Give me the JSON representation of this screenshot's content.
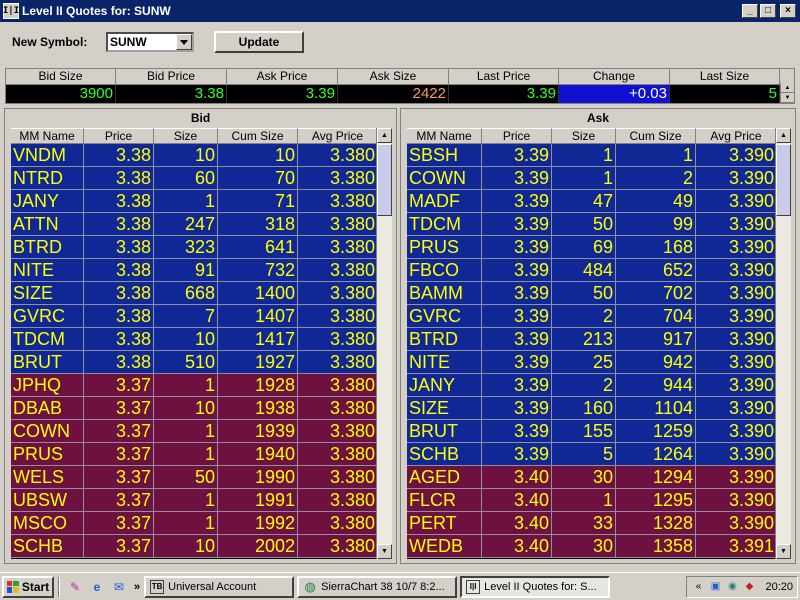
{
  "window": {
    "title": "Level II Quotes for: SUNW",
    "app_icon_text": "I|I",
    "min": "_",
    "max": "□",
    "close": "×"
  },
  "symbol": {
    "label": "New Symbol:",
    "value": "SUNW",
    "update_label": "Update"
  },
  "summary": {
    "headers": [
      "Bid Size",
      "Bid Price",
      "Ask Price",
      "Ask Size",
      "Last Price",
      "Change",
      "Last Size"
    ],
    "values": [
      "3900",
      "3.38",
      "3.39",
      "2422",
      "3.39",
      "+0.03",
      "5"
    ],
    "colors": {
      "bid_size": "#33ff33",
      "bid_price": "#33ff33",
      "ask_price": "#33ff33",
      "ask_size": "#ff9966",
      "last_price": "#33ff33",
      "change": "#ffffff",
      "change_bg": "#1010d0",
      "last_size": "#33ff33"
    }
  },
  "bid": {
    "title": "Bid",
    "columns": [
      "MM Name",
      "Price",
      "Size",
      "Cum Size",
      "Avg Price"
    ],
    "rows": [
      {
        "mm": "VNDM",
        "price": "3.38",
        "size": "10",
        "cum": "10",
        "avg": "3.380",
        "level": "blue"
      },
      {
        "mm": "NTRD",
        "price": "3.38",
        "size": "60",
        "cum": "70",
        "avg": "3.380",
        "level": "blue"
      },
      {
        "mm": "JANY",
        "price": "3.38",
        "size": "1",
        "cum": "71",
        "avg": "3.380",
        "level": "blue"
      },
      {
        "mm": "ATTN",
        "price": "3.38",
        "size": "247",
        "cum": "318",
        "avg": "3.380",
        "level": "blue"
      },
      {
        "mm": "BTRD",
        "price": "3.38",
        "size": "323",
        "cum": "641",
        "avg": "3.380",
        "level": "blue"
      },
      {
        "mm": "NITE",
        "price": "3.38",
        "size": "91",
        "cum": "732",
        "avg": "3.380",
        "level": "blue"
      },
      {
        "mm": "SIZE",
        "price": "3.38",
        "size": "668",
        "cum": "1400",
        "avg": "3.380",
        "level": "blue"
      },
      {
        "mm": "GVRC",
        "price": "3.38",
        "size": "7",
        "cum": "1407",
        "avg": "3.380",
        "level": "blue"
      },
      {
        "mm": "TDCM",
        "price": "3.38",
        "size": "10",
        "cum": "1417",
        "avg": "3.380",
        "level": "blue"
      },
      {
        "mm": "BRUT",
        "price": "3.38",
        "size": "510",
        "cum": "1927",
        "avg": "3.380",
        "level": "blue"
      },
      {
        "mm": "JPHQ",
        "price": "3.37",
        "size": "1",
        "cum": "1928",
        "avg": "3.380",
        "level": "maroon"
      },
      {
        "mm": "DBAB",
        "price": "3.37",
        "size": "10",
        "cum": "1938",
        "avg": "3.380",
        "level": "maroon"
      },
      {
        "mm": "COWN",
        "price": "3.37",
        "size": "1",
        "cum": "1939",
        "avg": "3.380",
        "level": "maroon"
      },
      {
        "mm": "PRUS",
        "price": "3.37",
        "size": "1",
        "cum": "1940",
        "avg": "3.380",
        "level": "maroon"
      },
      {
        "mm": "WELS",
        "price": "3.37",
        "size": "50",
        "cum": "1990",
        "avg": "3.380",
        "level": "maroon"
      },
      {
        "mm": "UBSW",
        "price": "3.37",
        "size": "1",
        "cum": "1991",
        "avg": "3.380",
        "level": "maroon"
      },
      {
        "mm": "MSCO",
        "price": "3.37",
        "size": "1",
        "cum": "1992",
        "avg": "3.380",
        "level": "maroon"
      },
      {
        "mm": "SCHB",
        "price": "3.37",
        "size": "10",
        "cum": "2002",
        "avg": "3.380",
        "level": "maroon"
      }
    ]
  },
  "ask": {
    "title": "Ask",
    "columns": [
      "MM Name",
      "Price",
      "Size",
      "Cum Size",
      "Avg Price"
    ],
    "rows": [
      {
        "mm": "SBSH",
        "price": "3.39",
        "size": "1",
        "cum": "1",
        "avg": "3.390",
        "level": "blue"
      },
      {
        "mm": "COWN",
        "price": "3.39",
        "size": "1",
        "cum": "2",
        "avg": "3.390",
        "level": "blue"
      },
      {
        "mm": "MADF",
        "price": "3.39",
        "size": "47",
        "cum": "49",
        "avg": "3.390",
        "level": "blue"
      },
      {
        "mm": "TDCM",
        "price": "3.39",
        "size": "50",
        "cum": "99",
        "avg": "3.390",
        "level": "blue"
      },
      {
        "mm": "PRUS",
        "price": "3.39",
        "size": "69",
        "cum": "168",
        "avg": "3.390",
        "level": "blue"
      },
      {
        "mm": "FBCO",
        "price": "3.39",
        "size": "484",
        "cum": "652",
        "avg": "3.390",
        "level": "blue"
      },
      {
        "mm": "BAMM",
        "price": "3.39",
        "size": "50",
        "cum": "702",
        "avg": "3.390",
        "level": "blue"
      },
      {
        "mm": "GVRC",
        "price": "3.39",
        "size": "2",
        "cum": "704",
        "avg": "3.390",
        "level": "blue"
      },
      {
        "mm": "BTRD",
        "price": "3.39",
        "size": "213",
        "cum": "917",
        "avg": "3.390",
        "level": "blue"
      },
      {
        "mm": "NITE",
        "price": "3.39",
        "size": "25",
        "cum": "942",
        "avg": "3.390",
        "level": "blue"
      },
      {
        "mm": "JANY",
        "price": "3.39",
        "size": "2",
        "cum": "944",
        "avg": "3.390",
        "level": "blue"
      },
      {
        "mm": "SIZE",
        "price": "3.39",
        "size": "160",
        "cum": "1104",
        "avg": "3.390",
        "level": "blue"
      },
      {
        "mm": "BRUT",
        "price": "3.39",
        "size": "155",
        "cum": "1259",
        "avg": "3.390",
        "level": "blue"
      },
      {
        "mm": "SCHB",
        "price": "3.39",
        "size": "5",
        "cum": "1264",
        "avg": "3.390",
        "level": "blue"
      },
      {
        "mm": "AGED",
        "price": "3.40",
        "size": "30",
        "cum": "1294",
        "avg": "3.390",
        "level": "maroon"
      },
      {
        "mm": "FLCR",
        "price": "3.40",
        "size": "1",
        "cum": "1295",
        "avg": "3.390",
        "level": "maroon"
      },
      {
        "mm": "PERT",
        "price": "3.40",
        "size": "33",
        "cum": "1328",
        "avg": "3.390",
        "level": "maroon"
      },
      {
        "mm": "WEDB",
        "price": "3.40",
        "size": "30",
        "cum": "1358",
        "avg": "3.391",
        "level": "maroon"
      }
    ]
  },
  "taskbar": {
    "start_label": "Start",
    "chevron": "»",
    "tasks": [
      {
        "label": "Universal Account",
        "icon": "TB",
        "active": false
      },
      {
        "label": "SierraChart 38  10/7  8:2...",
        "icon": "globe-icon",
        "active": false
      },
      {
        "label": "Level II Quotes for: S...",
        "icon": "I|I",
        "active": true
      }
    ],
    "tray_chevron": "«",
    "clock": "20:20"
  }
}
